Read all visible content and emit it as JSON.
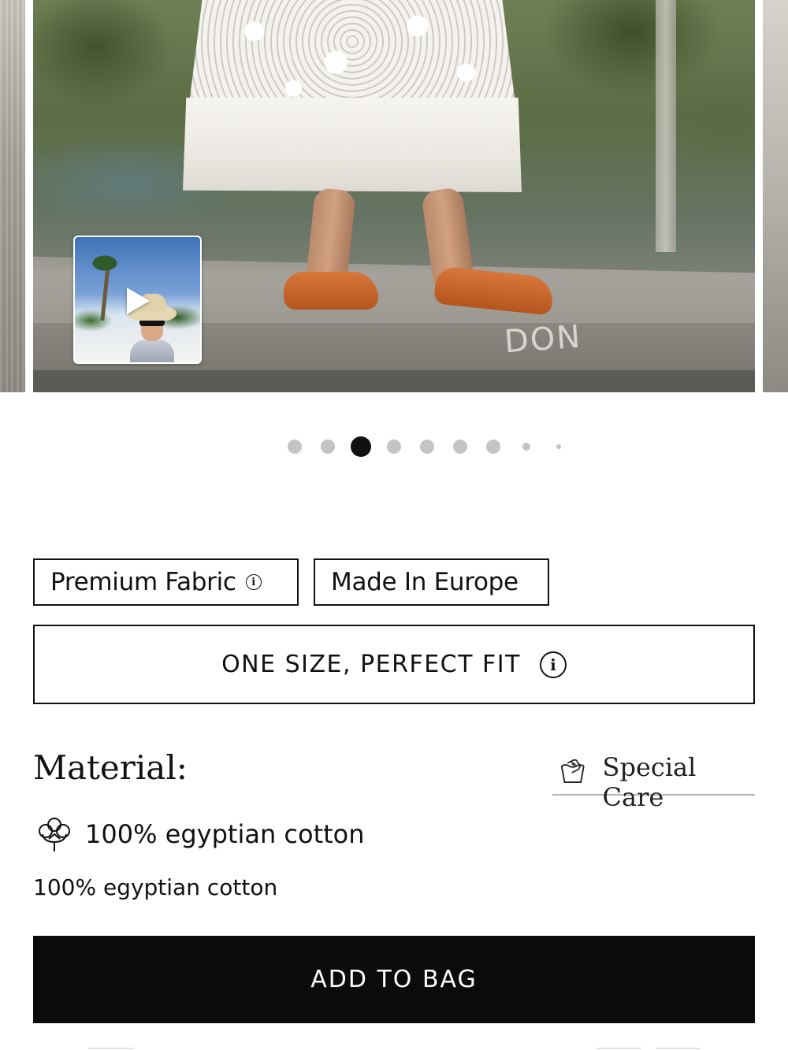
{
  "carousel": {
    "graffiti_text": "DON",
    "video": {
      "icon": "play-icon"
    },
    "pagination": {
      "total": 9,
      "active_index": 2,
      "active_color": "#111111",
      "inactive_color": "#c4c4c4"
    }
  },
  "badges": [
    {
      "label": "Premium Fabric",
      "icon": "info-icon"
    },
    {
      "label": "Made In Europe"
    }
  ],
  "size_option": {
    "label": "ONE SIZE, PERFECT FIT",
    "icon": "info-icon"
  },
  "material": {
    "title": "Material:",
    "care_link": {
      "label": "Special Care",
      "icon": "hand-wash-icon"
    },
    "composition": {
      "label": "100% egyptian cotton",
      "icon": "cotton-flower-icon"
    },
    "description": "100% egyptian cotton"
  },
  "cta": {
    "label": "ADD TO BAG",
    "background": "#0b0b0b",
    "color": "#ffffff"
  }
}
